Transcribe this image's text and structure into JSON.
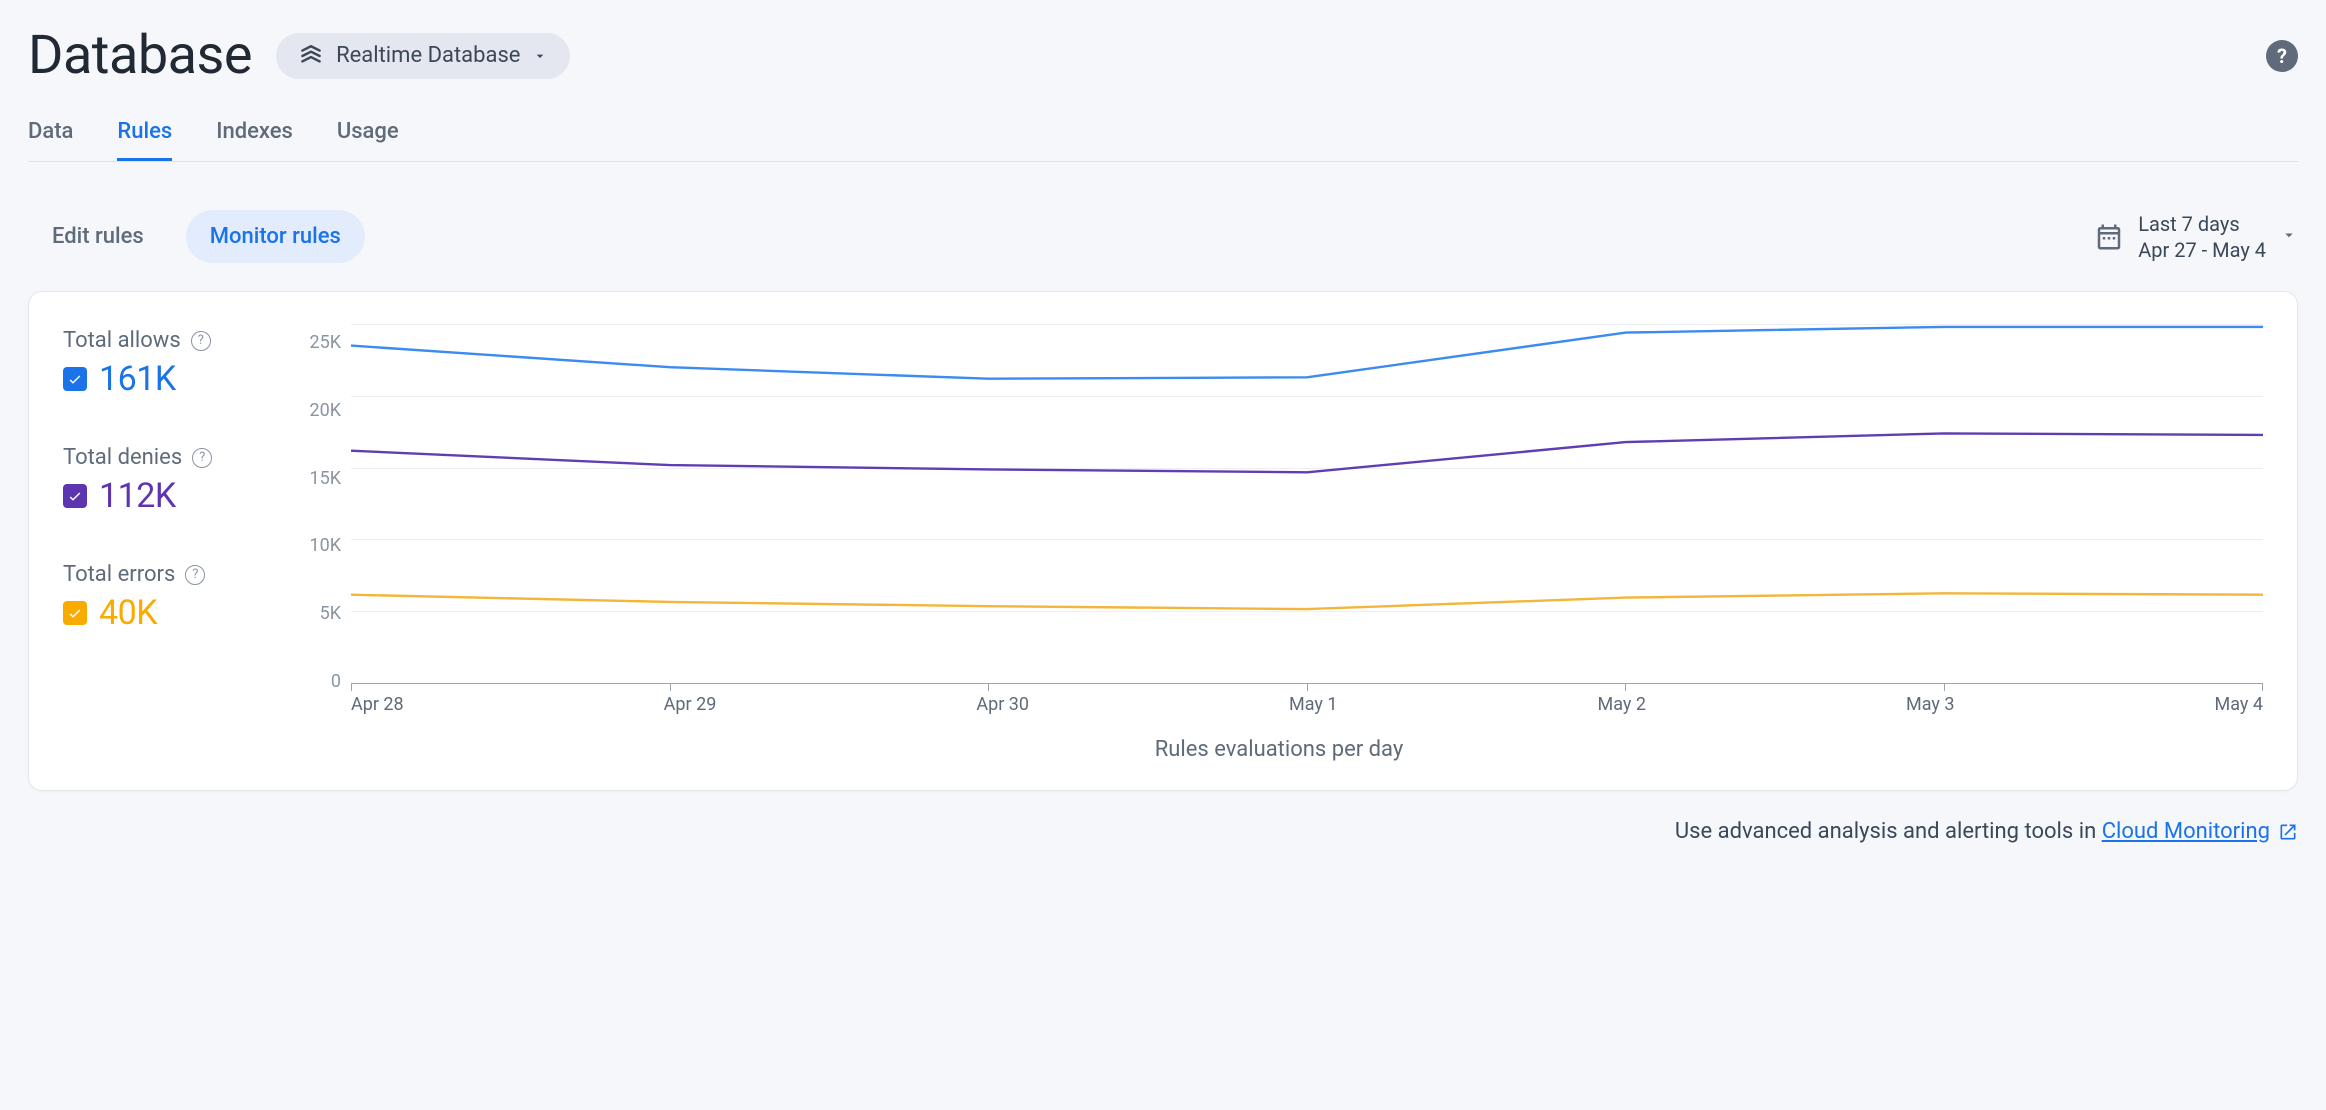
{
  "header": {
    "title": "Database",
    "selector_label": "Realtime Database"
  },
  "tabs": [
    "Data",
    "Rules",
    "Indexes",
    "Usage"
  ],
  "active_tab": "Rules",
  "subtabs": [
    "Edit rules",
    "Monitor rules"
  ],
  "active_subtab": "Monitor rules",
  "date_picker": {
    "preset": "Last 7 days",
    "range": "Apr 27 - May 4"
  },
  "legend": {
    "allows": {
      "label": "Total allows",
      "value": "161K",
      "checked": true,
      "color": "#1a73e8"
    },
    "denies": {
      "label": "Total denies",
      "value": "112K",
      "checked": true,
      "color": "#5e35b1"
    },
    "errors": {
      "label": "Total errors",
      "value": "40K",
      "checked": true,
      "color": "#f9ab00"
    }
  },
  "footer": {
    "prefix": "Use advanced analysis and alerting tools in ",
    "link_text": "Cloud Monitoring"
  },
  "chart_data": {
    "type": "line",
    "title": "",
    "xlabel": "Rules evaluations per day",
    "ylabel": "",
    "ylim": [
      0,
      25000
    ],
    "y_ticks": [
      "25K",
      "20K",
      "15K",
      "10K",
      "5K",
      "0"
    ],
    "categories": [
      "Apr 28",
      "Apr 29",
      "Apr 30",
      "May 1",
      "May 2",
      "May 3",
      "May 4"
    ],
    "series": [
      {
        "name": "Total allows",
        "color": "#3b8bf0",
        "values": [
          23500,
          22000,
          21200,
          21300,
          24400,
          24800,
          24800
        ]
      },
      {
        "name": "Total denies",
        "color": "#5f3eb3",
        "values": [
          16200,
          15200,
          14900,
          14700,
          16800,
          17400,
          17300
        ]
      },
      {
        "name": "Total errors",
        "color": "#f3b63a",
        "values": [
          6200,
          5700,
          5400,
          5200,
          6000,
          6300,
          6200
        ]
      }
    ]
  }
}
